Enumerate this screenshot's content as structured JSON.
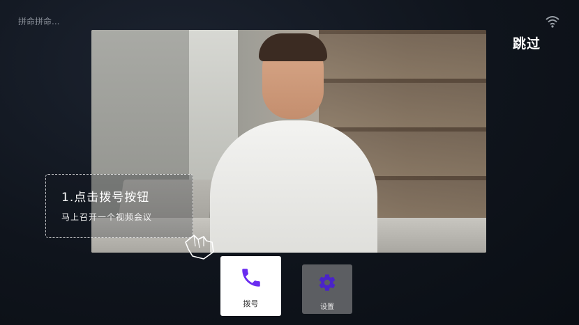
{
  "status": {
    "loading_text": "拼命拼命..."
  },
  "header": {
    "skip_label": "跳过"
  },
  "callout": {
    "title": "1.点击拨号按钮",
    "subtitle": "马上召开一个视频会议"
  },
  "buttons": {
    "dial": {
      "label": "拨号",
      "icon": "phone-icon"
    },
    "settings": {
      "label": "设置",
      "icon": "gear-icon"
    }
  },
  "colors": {
    "accent": "#6a2cf0",
    "background": "#0f141c",
    "dial_bg": "#ffffff",
    "settings_bg": "#5c5e62"
  }
}
